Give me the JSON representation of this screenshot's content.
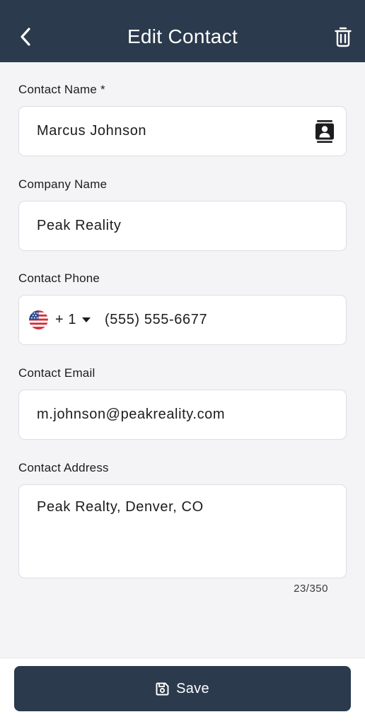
{
  "header": {
    "title": "Edit Contact",
    "back_icon": "chevron-left-icon",
    "delete_icon": "trash-icon",
    "background": "#2b3a4d"
  },
  "form": {
    "contact_name": {
      "label": "Contact Name *",
      "value": "Marcus Johnson",
      "icon": "contact-book-icon"
    },
    "company_name": {
      "label": "Company Name",
      "value": "Peak Reality"
    },
    "contact_phone": {
      "label": "Contact Phone",
      "country_flag_icon": "us-flag-icon",
      "country_code": "+ 1",
      "value": "(555) 555-6677"
    },
    "contact_email": {
      "label": "Contact Email",
      "value": "m.johnson@peakreality.com"
    },
    "contact_address": {
      "label": "Contact Address",
      "value": "Peak Realty, Denver, CO",
      "char_counter": "23/350"
    }
  },
  "footer": {
    "save_label": "Save",
    "save_icon": "floppy-disk-icon"
  }
}
